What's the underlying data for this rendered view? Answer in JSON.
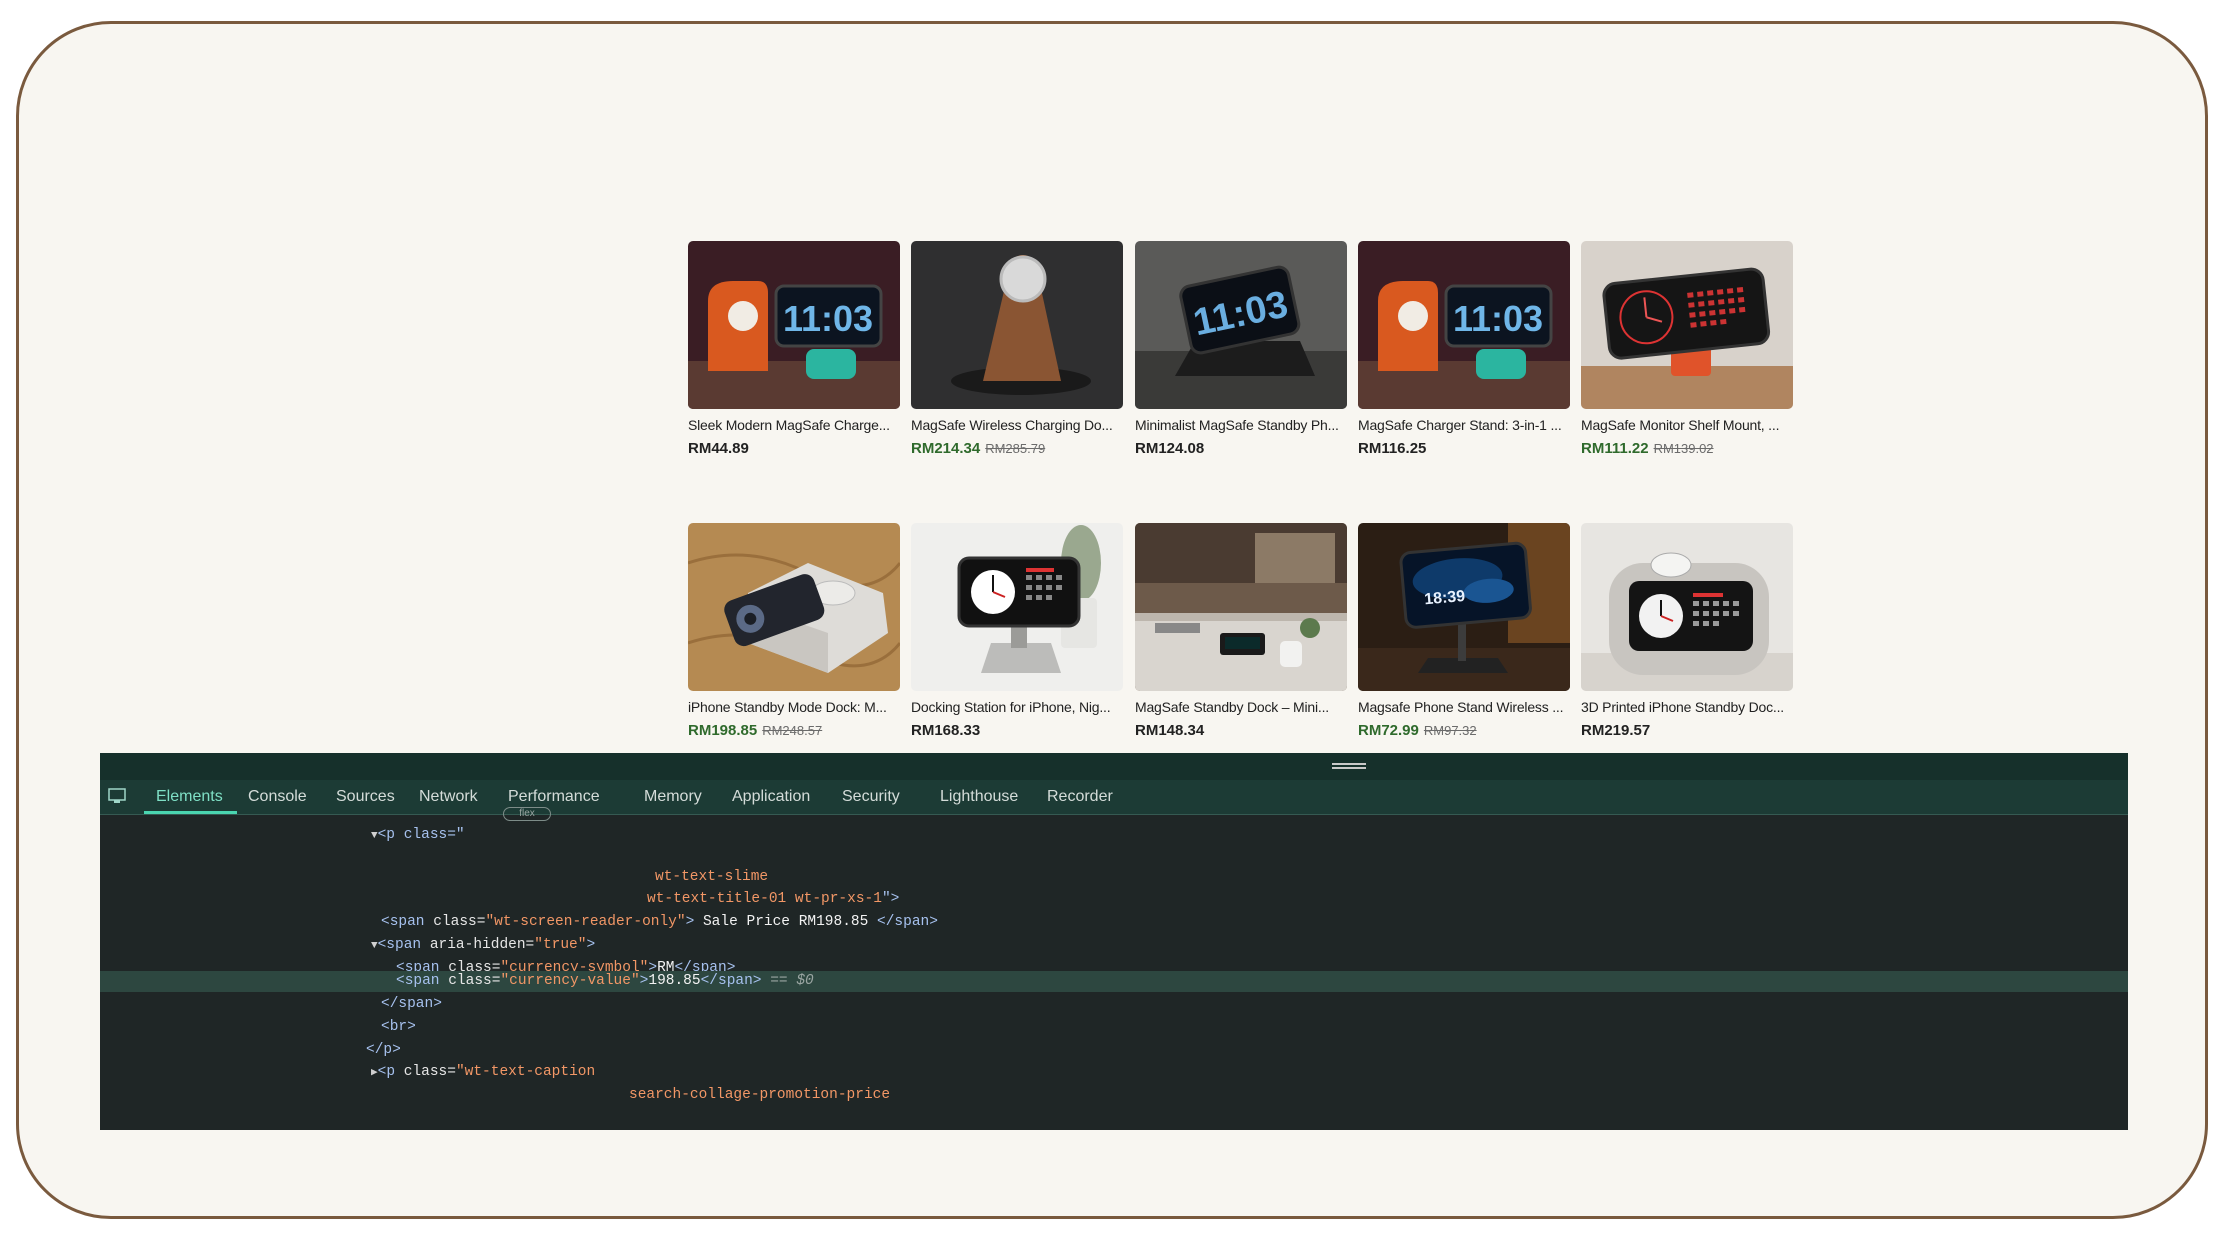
{
  "products_row1": [
    {
      "title": "Sleek Modern MagSafe Charge...",
      "price": "RM44.89",
      "sale": false,
      "original": ""
    },
    {
      "title": "MagSafe Wireless Charging Do...",
      "price": "RM214.34",
      "sale": true,
      "original": "RM285.79"
    },
    {
      "title": "Minimalist MagSafe Standby Ph...",
      "price": "RM124.08",
      "sale": false,
      "original": ""
    },
    {
      "title": "MagSafe Charger Stand: 3-in-1 ...",
      "price": "RM116.25",
      "sale": false,
      "original": ""
    },
    {
      "title": "MagSafe Monitor Shelf Mount, ...",
      "price": "RM111.22",
      "sale": true,
      "original": "RM139.02"
    }
  ],
  "products_row2": [
    {
      "title": "iPhone Standby Mode Dock: M...",
      "price": "RM198.85",
      "sale": true,
      "original": "RM248.57"
    },
    {
      "title": "Docking Station for iPhone, Nig...",
      "price": "RM168.33",
      "sale": false,
      "original": ""
    },
    {
      "title": "MagSafe Standby Dock – Mini...",
      "price": "RM148.34",
      "sale": false,
      "original": ""
    },
    {
      "title": "Magsafe Phone Stand Wireless ...",
      "price": "RM72.99",
      "sale": true,
      "original": "RM97.32"
    },
    {
      "title": "3D Printed iPhone Standby Doc...",
      "price": "RM219.57",
      "sale": false,
      "original": ""
    }
  ],
  "colors": {
    "sale_price": "#2f6a2c",
    "frame_border": "#7a5a3e",
    "devtools_bg": "#1f2626",
    "active_tab": "#7fe0c6"
  },
  "devtools": {
    "tabs": [
      "Elements",
      "Console",
      "Sources",
      "Network",
      "Performance",
      "Memory",
      "Application",
      "Security",
      "Lighthouse",
      "Recorder"
    ],
    "active_tab": "Elements",
    "badge": "flex",
    "code": {
      "l1_tag": "<p class=\"",
      "l2_val": "wt-text-slime",
      "l3_val": "wt-text-title-01 wt-pr-xs-1",
      "l3_close": "\">",
      "l4_open": "<span ",
      "l4_attr": "class=",
      "l4_val": "\"wt-screen-reader-only\"",
      "l4_gt": ">",
      "l4_text": " Sale Price RM198.85 ",
      "l4_close": "</span>",
      "l5_open": "<span ",
      "l5_attr": "aria-hidden=",
      "l5_val": "\"true\"",
      "l5_gt": ">",
      "l6_open": "<span ",
      "l6_attr": "class=",
      "l6_val": "\"currency-symbol\"",
      "l6_gt": ">",
      "l6_text": "RM",
      "l6_close": "</span>",
      "l7_open": "<span ",
      "l7_attr": "class=",
      "l7_val": "\"currency-value\"",
      "l7_gt": ">",
      "l7_text": "198.85",
      "l7_close": "</span>",
      "l7_ref": " == $0",
      "l8": "</span>",
      "l9": "<br>",
      "l10": "</p>",
      "l11_open": "<p ",
      "l11_attr": "class=",
      "l11_val": "\"wt-text-caption",
      "l12_val": "search-collage-promotion-price"
    }
  }
}
